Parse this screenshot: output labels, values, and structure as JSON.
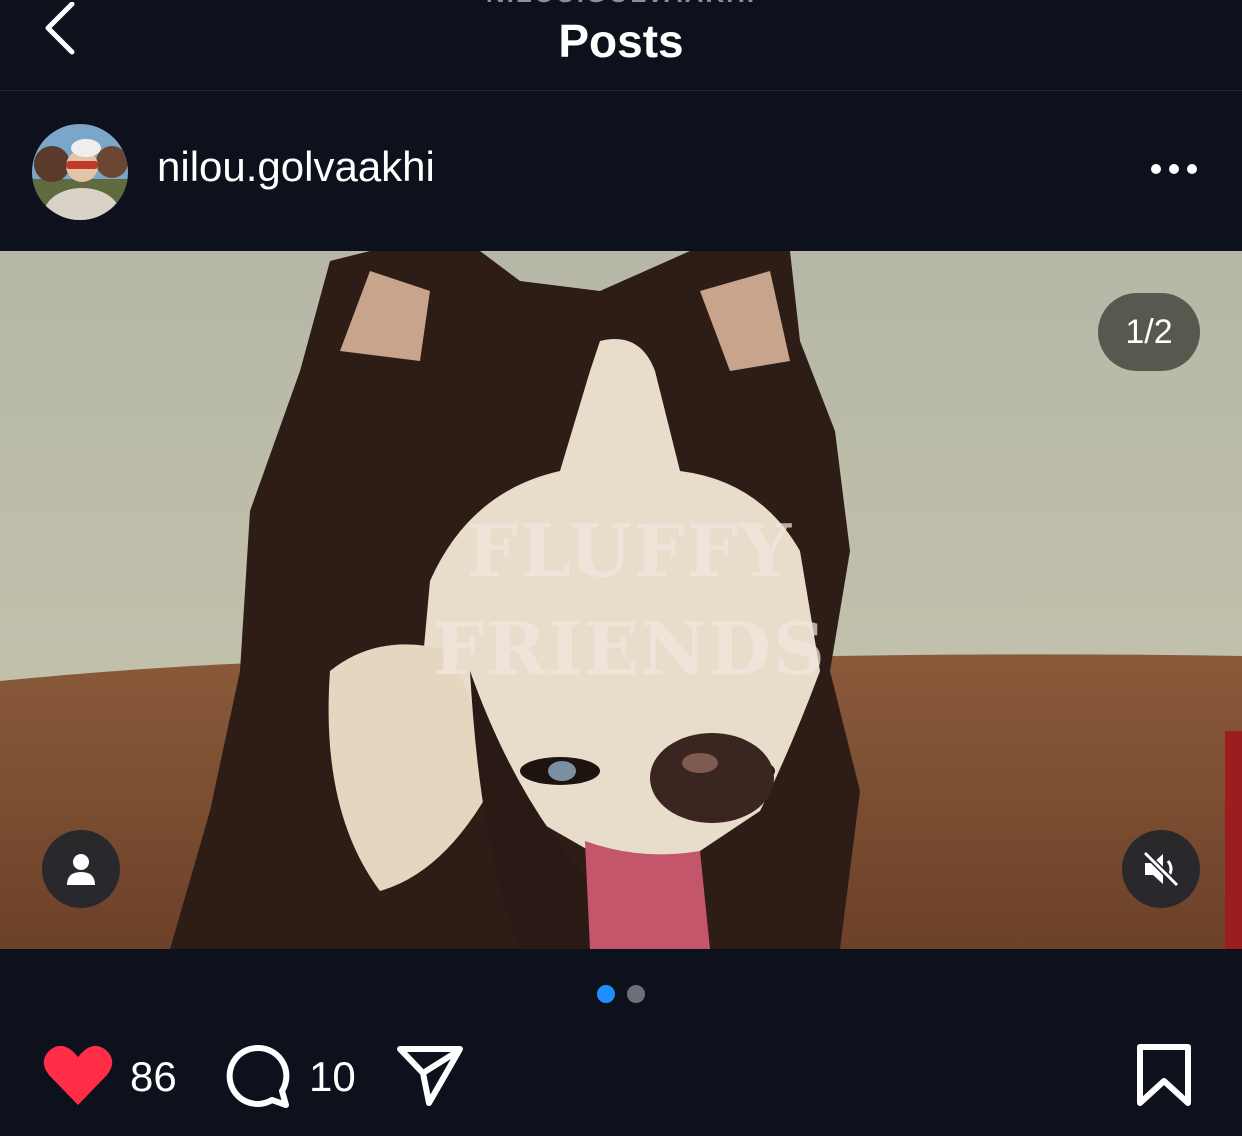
{
  "header": {
    "subtitle": "NILOU.GOLVAAKHI",
    "title": "Posts"
  },
  "post": {
    "username": "nilou.golvaakhi",
    "media": {
      "counter": "1/2",
      "overlay_line1": "FLUFFY",
      "overlay_line2": "FRIENDS"
    },
    "carousel": {
      "total": 2,
      "active_index": 0
    },
    "likes_count": "86",
    "comments_count": "10"
  },
  "colors": {
    "background": "#0c111b",
    "like_red": "#ff2d45",
    "dot_active": "#1f8fff",
    "dot_inactive": "#6c6f78"
  },
  "icons": [
    "chevron-left-icon",
    "more-horizontal-icon",
    "user-tag-icon",
    "speaker-muted-icon",
    "heart-icon",
    "comment-icon",
    "send-icon",
    "bookmark-icon"
  ]
}
